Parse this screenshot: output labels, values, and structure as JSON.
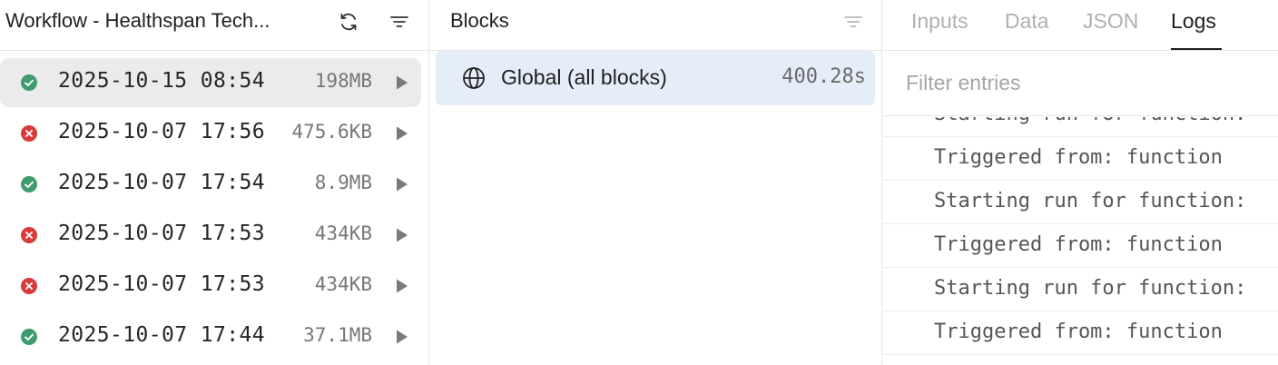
{
  "runs_panel": {
    "title": "Workflow - Healthspan Tech...",
    "runs": [
      {
        "status": "success",
        "timestamp": "2025-10-15 08:54",
        "size": "198MB",
        "selected": true
      },
      {
        "status": "error",
        "timestamp": "2025-10-07 17:56",
        "size": "475.6KB",
        "selected": false
      },
      {
        "status": "success",
        "timestamp": "2025-10-07 17:54",
        "size": "8.9MB",
        "selected": false
      },
      {
        "status": "error",
        "timestamp": "2025-10-07 17:53",
        "size": "434KB",
        "selected": false
      },
      {
        "status": "error",
        "timestamp": "2025-10-07 17:53",
        "size": "434KB",
        "selected": false
      },
      {
        "status": "success",
        "timestamp": "2025-10-07 17:44",
        "size": "37.1MB",
        "selected": false
      }
    ]
  },
  "blocks_panel": {
    "title": "Blocks",
    "items": [
      {
        "label": "Global (all blocks)",
        "duration": "400.28s",
        "selected": true
      }
    ]
  },
  "detail_panel": {
    "tabs": [
      {
        "label": "Inputs",
        "active": false
      },
      {
        "label": "Data",
        "active": false
      },
      {
        "label": "JSON",
        "active": false
      },
      {
        "label": "Logs",
        "active": true
      }
    ],
    "filter": {
      "placeholder": "Filter entries",
      "value": ""
    },
    "log_entries": [
      "Starting run for function:",
      "Triggered from: function",
      "Starting run for function:",
      "Triggered from: function",
      "Starting run for function:",
      "Triggered from: function"
    ]
  },
  "colors": {
    "success": "#3e9c6e",
    "error": "#d93b3b",
    "selected_run_bg": "#ebebeb",
    "selected_block_bg": "#e4edf8",
    "icon_gray": "#7a7a7a"
  },
  "icons": {
    "refresh": "refresh-icon",
    "filter": "filter-icon",
    "play": "play-icon",
    "globe": "globe-icon",
    "success": "check-circle-icon",
    "error": "x-circle-icon"
  }
}
